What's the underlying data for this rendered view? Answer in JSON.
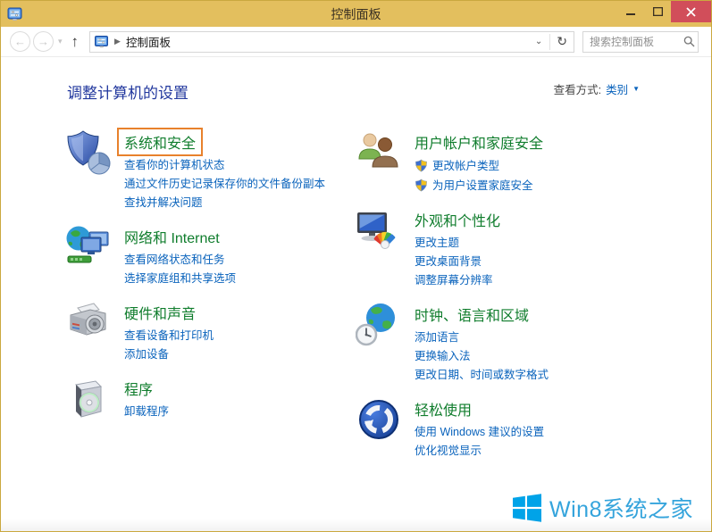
{
  "window": {
    "title": "控制面板"
  },
  "toolbar": {
    "breadcrumb_root": "控制面板",
    "search_placeholder": "搜索控制面板"
  },
  "header": {
    "title": "调整计算机的设置",
    "view_by_label": "查看方式:",
    "view_by_value": "类别"
  },
  "categories": {
    "left": [
      {
        "id": "system-security",
        "icon": "shield-pie",
        "title": "系统和安全",
        "highlighted": true,
        "links": [
          {
            "label": "查看你的计算机状态"
          },
          {
            "label": "通过文件历史记录保存你的文件备份副本"
          },
          {
            "label": "查找并解决问题"
          }
        ]
      },
      {
        "id": "network-internet",
        "icon": "globe-monitors",
        "title": "网络和 Internet",
        "links": [
          {
            "label": "查看网络状态和任务"
          },
          {
            "label": "选择家庭组和共享选项"
          }
        ]
      },
      {
        "id": "hardware-sound",
        "icon": "printer-speaker",
        "title": "硬件和声音",
        "links": [
          {
            "label": "查看设备和打印机"
          },
          {
            "label": "添加设备"
          }
        ]
      },
      {
        "id": "programs",
        "icon": "software-box",
        "title": "程序",
        "links": [
          {
            "label": "卸载程序"
          }
        ]
      }
    ],
    "right": [
      {
        "id": "user-accounts-family-safety",
        "icon": "two-users",
        "title": "用户帐户和家庭安全",
        "links": [
          {
            "label": "更改帐户类型",
            "shield": true
          },
          {
            "label": "为用户设置家庭安全",
            "shield": true
          }
        ]
      },
      {
        "id": "appearance-personalization",
        "icon": "monitor-colors",
        "title": "外观和个性化",
        "links": [
          {
            "label": "更改主题"
          },
          {
            "label": "更改桌面背景"
          },
          {
            "label": "调整屏幕分辨率"
          }
        ]
      },
      {
        "id": "clock-language-region",
        "icon": "globe-clock",
        "title": "时钟、语言和区域",
        "links": [
          {
            "label": "添加语言"
          },
          {
            "label": "更换输入法"
          },
          {
            "label": "更改日期、时间或数字格式"
          }
        ]
      },
      {
        "id": "ease-of-access",
        "icon": "ease-circle",
        "title": "轻松使用",
        "links": [
          {
            "label": "使用 Windows 建议的设置"
          },
          {
            "label": "优化视觉显示"
          }
        ]
      }
    ]
  },
  "watermark": {
    "text": "Win8系统之家"
  },
  "colors": {
    "titlebar_gold": "#e3bf5e",
    "close_red": "#d14e5a",
    "category_green": "#107d2d",
    "task_link_blue": "#0a63bc",
    "page_title_navy": "#22389e",
    "highlight_orange": "#e8812c",
    "watermark_blue": "#35a4dc",
    "windows_logo_blue": "#00a3e8"
  }
}
